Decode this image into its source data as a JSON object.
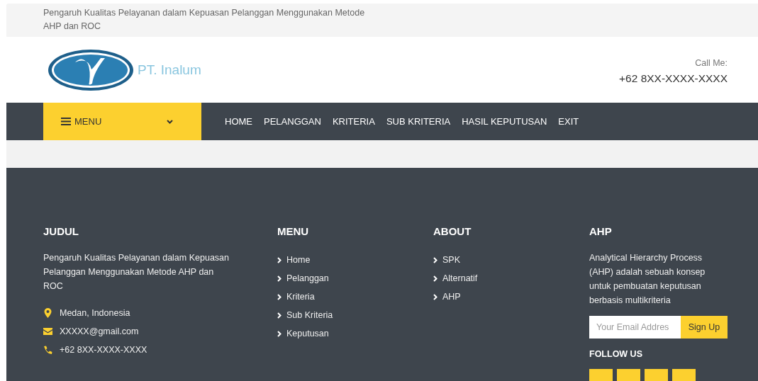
{
  "top_bar": {
    "text": "Pengaruh Kualitas Pelayanan dalam Kepuasan Pelanggan Menggunakan Metode AHP dan ROC"
  },
  "header": {
    "brand": "PT. Inalum",
    "call_label": "Call Me:",
    "phone": "+62 8XX-XXXX-XXXX"
  },
  "nav": {
    "menu_button": "MENU",
    "items": [
      {
        "label": "HOME"
      },
      {
        "label": "PELANGGAN"
      },
      {
        "label": "KRITERIA"
      },
      {
        "label": "SUB KRITERIA"
      },
      {
        "label": "HASIL KEPUTUSAN"
      },
      {
        "label": "EXIT"
      }
    ]
  },
  "footer": {
    "judul": {
      "heading": "JUDUL",
      "text": "Pengaruh Kualitas Pelayanan dalam Kepuasan Pelanggan Menggunakan Metode AHP dan ROC",
      "contacts": [
        {
          "kind": "location",
          "text": "Medan, Indonesia"
        },
        {
          "kind": "email",
          "text": "XXXXX@gmail.com"
        },
        {
          "kind": "phone",
          "text": "+62 8XX-XXXX-XXXX"
        }
      ]
    },
    "menu": {
      "heading": "MENU",
      "links": [
        "Home",
        "Pelanggan",
        "Kriteria",
        "Sub Kriteria",
        "Keputusan"
      ]
    },
    "about": {
      "heading": "ABOUT",
      "links": [
        "SPK",
        "Alternatif",
        "AHP"
      ]
    },
    "ahp": {
      "heading": "AHP",
      "text": "Analytical Hierarchy Process (AHP) adalah sebuah konsep untuk pembuatan keputusan berbasis multikriteria",
      "email_placeholder": "Your Email Addres",
      "signup": "Sign Up",
      "follow": "FOLLOW US",
      "social_buttons": [
        {
          "kind": "social"
        },
        {
          "kind": "social"
        },
        {
          "kind": "social"
        },
        {
          "kind": "social"
        }
      ]
    }
  }
}
